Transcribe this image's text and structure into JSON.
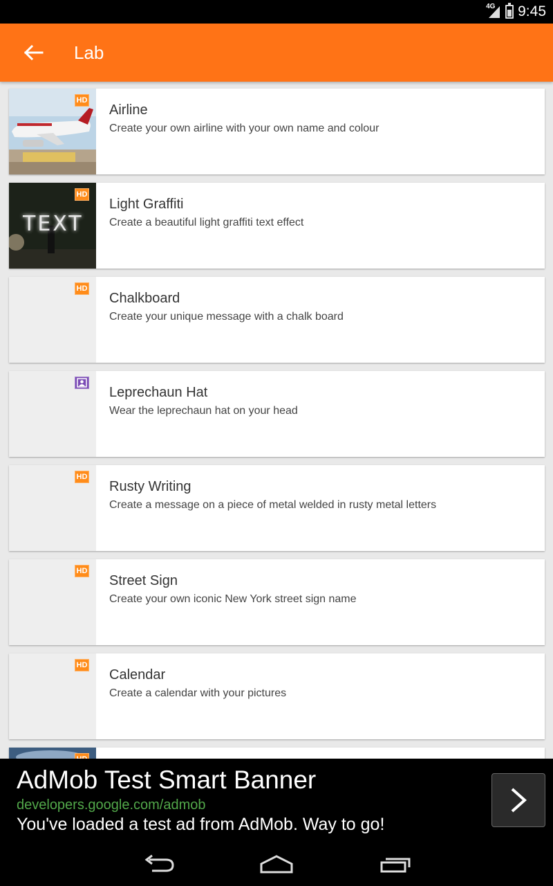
{
  "status": {
    "network": "4G",
    "time": "9:45"
  },
  "appbar": {
    "title": "Lab"
  },
  "items": [
    {
      "title": "Airline",
      "description": "Create your own airline with your own name and colour",
      "badge": "HD",
      "thumb": "airplane"
    },
    {
      "title": "Light Graffiti",
      "description": "Create a beautiful light graffiti text effect",
      "badge": "HD",
      "thumb": "graffiti",
      "thumb_text": "TEXT"
    },
    {
      "title": "Chalkboard",
      "description": "Create your unique message with a chalk board",
      "badge": "HD",
      "thumb": "blank"
    },
    {
      "title": "Leprechaun Hat",
      "description": "Wear the leprechaun hat on your head",
      "badge": "face",
      "thumb": "blank"
    },
    {
      "title": "Rusty Writing",
      "description": "Create a message on a piece of metal welded in rusty metal letters",
      "badge": "HD",
      "thumb": "blank"
    },
    {
      "title": "Street Sign",
      "description": "Create your own iconic New York street sign name",
      "badge": "HD",
      "thumb": "blank"
    },
    {
      "title": "Calendar",
      "description": "Create a calendar with your pictures",
      "badge": "HD",
      "thumb": "blank"
    },
    {
      "title": "",
      "description": "",
      "badge": "HD",
      "thumb": "sky"
    }
  ],
  "ad": {
    "title": "AdMob Test Smart Banner",
    "url": "developers.google.com/admob",
    "description": "You've loaded a test ad from AdMob. Way to go!"
  },
  "colors": {
    "accent": "#ff7316",
    "badge": "#ff8c1a",
    "badge_face": "#7a4bb5",
    "ad_url": "#52a84a"
  }
}
